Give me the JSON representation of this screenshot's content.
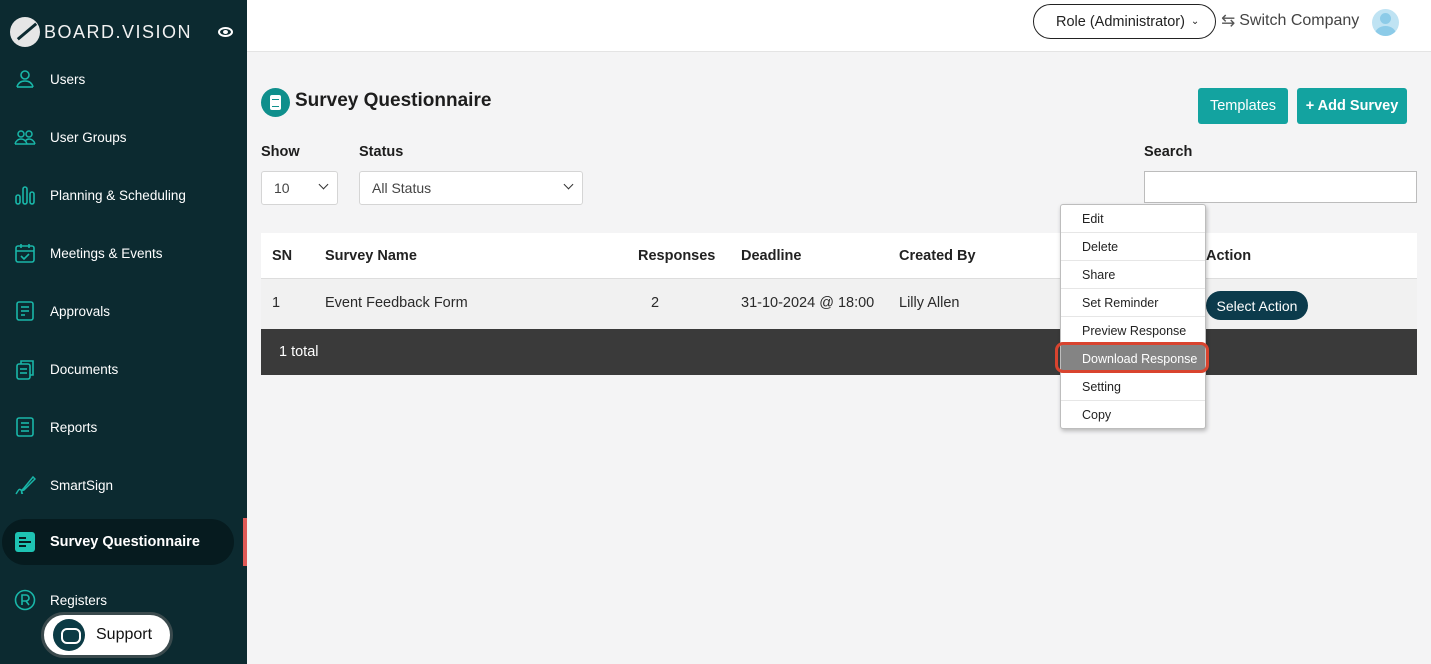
{
  "brand": {
    "name": "BOARD.VISION"
  },
  "sidebar": {
    "items": [
      {
        "label": "Users",
        "icon": "user-icon"
      },
      {
        "label": "User Groups",
        "icon": "user-group-icon"
      },
      {
        "label": "Planning & Scheduling",
        "icon": "bar-chart-icon"
      },
      {
        "label": "Meetings & Events",
        "icon": "calendar-icon"
      },
      {
        "label": "Approvals",
        "icon": "approval-doc-icon"
      },
      {
        "label": "Documents",
        "icon": "documents-icon"
      },
      {
        "label": "Reports",
        "icon": "report-icon"
      },
      {
        "label": "SmartSign",
        "icon": "pen-signature-icon"
      },
      {
        "label": "Survey Questionnaire",
        "icon": "survey-icon",
        "active": true
      },
      {
        "label": "Registers",
        "icon": "registered-icon"
      }
    ],
    "support_label": "Support"
  },
  "header": {
    "role_label": "Role (Administrator)",
    "switch_company_label": "Switch Company"
  },
  "page": {
    "title": "Survey Questionnaire",
    "templates_label": "Templates",
    "add_survey_label": "+ Add Survey"
  },
  "filters": {
    "show_label": "Show",
    "show_value": "10",
    "status_label": "Status",
    "status_value": "All Status",
    "search_label": "Search",
    "search_value": ""
  },
  "table": {
    "headers": {
      "sn": "SN",
      "survey_name": "Survey Name",
      "responses": "Responses",
      "deadline": "Deadline",
      "created_by": "Created By",
      "action": "Action"
    },
    "rows": [
      {
        "sn": "1",
        "survey_name": "Event Feedback Form",
        "responses": "2",
        "deadline": "31-10-2024 @ 18:00",
        "created_by": "Lilly Allen",
        "action_label": "Select Action"
      }
    ],
    "footer_total": "1 total"
  },
  "action_menu": {
    "items": [
      "Edit",
      "Delete",
      "Share",
      "Set Reminder",
      "Preview Response",
      "Download Response",
      "Setting",
      "Copy"
    ],
    "highlighted": "Download Response"
  },
  "colors": {
    "sidebar_bg": "#0c2a30",
    "accent_teal": "#13a3a0",
    "action_button": "#0c3b4c",
    "active_indicator": "#e05a57",
    "highlight_ring": "#d9442f"
  }
}
